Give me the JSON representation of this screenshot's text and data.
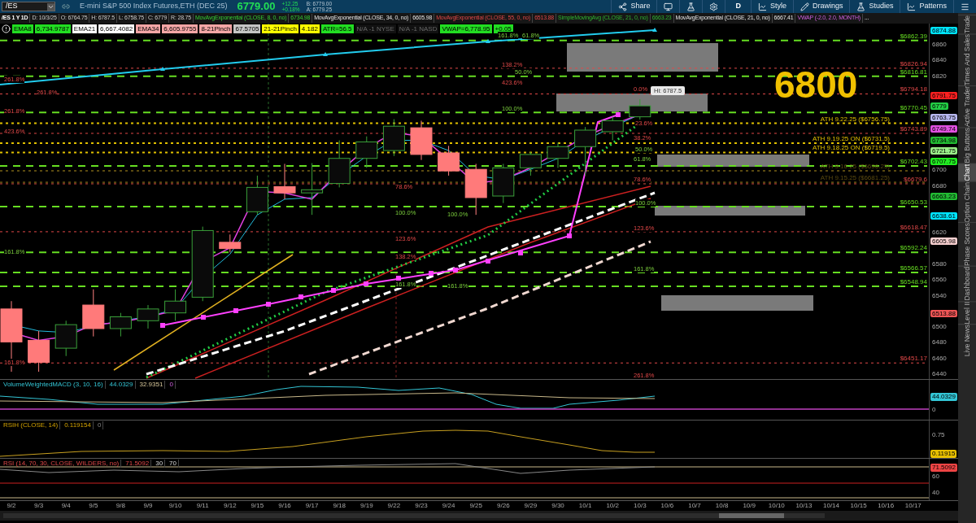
{
  "toolbar": {
    "symbol": "/ES",
    "description": "E-mini S&P 500 Index Futures,ETH (DEC 25)",
    "last": "6779.00",
    "change": "+12.25",
    "change_pct": "+0.18%",
    "bid": "B: 6779.00",
    "ask": "A: 6779.25",
    "buttons": [
      {
        "kind": "share",
        "label": "Share"
      },
      {
        "kind": "screen"
      },
      {
        "kind": "flask"
      },
      {
        "kind": "gear"
      },
      {
        "kind": "text",
        "label": "D"
      },
      {
        "kind": "style",
        "label": "Style"
      },
      {
        "kind": "drawings",
        "label": "Drawings"
      },
      {
        "kind": "studies",
        "label": "Studies"
      },
      {
        "kind": "patterns",
        "label": "Patterns"
      },
      {
        "kind": "menu"
      }
    ]
  },
  "legend": {
    "symbol": "/ES 1 Y 1D",
    "fields": [
      "D: 10/3/25",
      "O: 6764.75",
      "H: 6787.5",
      "L: 6758.75",
      "C: 6779",
      "R: 28.75"
    ],
    "studies": [
      {
        "name": "MovAvgExponential (CLOSE, 8, 0, no)",
        "value": "6734.98",
        "kind": "ema8"
      },
      {
        "name": "MovAvgExponential (CLOSE, 34, 0, no)",
        "value": "6605.98",
        "kind": "ema34"
      },
      {
        "name": "MovAvgExponential (CLOSE, 55, 0, no)",
        "value": "6513.88",
        "kind": "ema55"
      },
      {
        "name": "SimpleMovingAvg (CLOSE, 21, 0, no)",
        "value": "6663.23",
        "kind": "sma21"
      },
      {
        "name": "MovAvgExponential (CLOSE, 21, 0, no)",
        "value": "6667.41",
        "kind": "ema21"
      },
      {
        "name": "VWAP (-2.0, 2.0, MONTH)",
        "kind": "vwap"
      }
    ],
    "more": "..."
  },
  "chips": [
    {
      "text": "EMA8",
      "color": "#22dd22",
      "disabled": false
    },
    {
      "text": "6,734.9787",
      "color": "#22dd22",
      "disabled": false
    },
    {
      "text": "EMA21",
      "color": "#ffffff",
      "disabled": false
    },
    {
      "text": "6,667.4082",
      "color": "#ffffff",
      "disabled": false
    },
    {
      "text": "EMA34",
      "color": "#f4a6a6",
      "disabled": false
    },
    {
      "text": "6,605.9755",
      "color": "#f4a6a6",
      "disabled": false
    },
    {
      "text": "8-21Pinch",
      "color": "#f4a6a6",
      "disabled": false
    },
    {
      "text": "67.5705",
      "color": "#c4c4c4",
      "disabled": false
    },
    {
      "text": "21-21Pinch",
      "color": "#ffff00",
      "disabled": false
    },
    {
      "text": "4.182",
      "color": "#ffff00",
      "disabled": false
    },
    {
      "text": "ATR=56.5",
      "color": "#22dd22",
      "disabled": false
    },
    {
      "text": "N/A -1 NYSE",
      "color": "#111111",
      "disabled": true
    },
    {
      "text": "N/A -1 NASD",
      "color": "#111111",
      "disabled": true
    },
    {
      "text": "VWAP=6,778.95",
      "color": "#22dd22",
      "disabled": false
    },
    {
      "text": "+0.05",
      "color": "#22dd22",
      "disabled": false
    }
  ],
  "callout": "6800",
  "high_label": "Hi: 6787.5",
  "fib_labels": [
    {
      "text": "161.8%",
      "kind": "support"
    },
    {
      "text": "61.8%",
      "kind": "support"
    },
    {
      "text": "138.2%",
      "kind": "resistance"
    },
    {
      "text": "50.0%",
      "kind": "support"
    },
    {
      "text": "261.8%",
      "kind": "resistance"
    },
    {
      "text": "423.6%",
      "kind": "resistance"
    },
    {
      "text": "0.0%",
      "kind": "resistance"
    },
    {
      "text": "261.8%",
      "kind": "resistance"
    },
    {
      "text": "100.0%",
      "kind": "support"
    },
    {
      "text": "261.8%",
      "kind": "resistance"
    },
    {
      "text": "23.6%",
      "kind": "resistance"
    },
    {
      "text": "423.6%",
      "kind": "resistance"
    },
    {
      "text": "38.2%",
      "kind": "resistance"
    },
    {
      "text": "50.0%",
      "kind": "support"
    },
    {
      "text": "61.8%",
      "kind": "support"
    },
    {
      "text": "78.6%",
      "kind": "resistance"
    },
    {
      "text": "78.6%",
      "kind": "resistance"
    },
    {
      "text": "100.0%",
      "kind": "support"
    },
    {
      "text": "100.0%",
      "kind": "support"
    },
    {
      "text": "100.0%",
      "kind": "support"
    },
    {
      "text": "123.6%",
      "kind": "resistance"
    },
    {
      "text": "123.6%",
      "kind": "resistance"
    },
    {
      "text": "161.8%",
      "kind": "support"
    },
    {
      "text": "138.2%",
      "kind": "resistance"
    },
    {
      "text": "161.8%",
      "kind": "support"
    },
    {
      "text": "161.8%",
      "kind": "support"
    },
    {
      "text": "161.8%",
      "kind": "support"
    },
    {
      "text": "161.8%",
      "kind": "resistance"
    },
    {
      "text": "261.8%",
      "kind": "resistance"
    }
  ],
  "levels": [
    {
      "label": "$6862.39",
      "kind": "support"
    },
    {
      "label": "$6826.94",
      "kind": "resistance"
    },
    {
      "label": "$6816.81",
      "kind": "support"
    },
    {
      "label": "$6794.18",
      "kind": "resistance"
    },
    {
      "label": "$6770.45",
      "kind": "support"
    },
    {
      "label": "$6743.89",
      "kind": "resistance"
    },
    {
      "label": "$6702.43",
      "kind": "support"
    },
    {
      "label": "$6679.6",
      "kind": "resistance"
    },
    {
      "label": "$6650.53",
      "kind": "support"
    },
    {
      "label": "$6618.47",
      "kind": "resistance"
    },
    {
      "label": "$6592.24",
      "kind": "support"
    },
    {
      "label": "$6566.57",
      "kind": "support"
    },
    {
      "label": "$6548.94",
      "kind": "support"
    },
    {
      "label": "$6451.17",
      "kind": "resistance"
    }
  ],
  "ath_levels": [
    {
      "label": "ATH 9.22.25  ($6756.75)",
      "disabled": false
    },
    {
      "label": "ATH 9.19.25 ON ($6731.5)",
      "disabled": false
    },
    {
      "label": "ATH 9.18.25 ON ($6719.5)",
      "disabled": false
    },
    {
      "label": "ATH 9.16.25 ($6696.25)",
      "disabled": true
    },
    {
      "label": "ATH 9.15.25 ($6681.25)",
      "disabled": true
    }
  ],
  "price_tags": [
    {
      "value": "6874.88",
      "color": "#00e5ff"
    },
    {
      "value": "6791.75",
      "color": "#ff2020"
    },
    {
      "value": "6779",
      "color": "#22cc44"
    },
    {
      "value": "6763.75",
      "color": "#b8b8f0"
    },
    {
      "value": "6749.74",
      "color": "#e050e0"
    },
    {
      "value": "6734.98",
      "color": "#22bb33"
    },
    {
      "value": "6721.75",
      "color": "#99ee88"
    },
    {
      "value": "6707.75",
      "color": "#22ee22"
    },
    {
      "value": "6663.23",
      "color": "#22bb33"
    },
    {
      "value": "6638.61",
      "color": "#00e5ff"
    },
    {
      "value": "6605.98",
      "color": "#f8d0d0"
    },
    {
      "value": "6513.88",
      "color": "#ee5555"
    }
  ],
  "price_ticks": [
    "6860",
    "6840",
    "6820",
    "6700",
    "6680",
    "6620",
    "6580",
    "6560",
    "6540",
    "6500",
    "6480",
    "6460",
    "6440"
  ],
  "dates": [
    "9/2",
    "9/3",
    "9/4",
    "9/5",
    "9/8",
    "9/9",
    "9/10",
    "9/11",
    "9/12",
    "9/15",
    "9/16",
    "9/17",
    "9/18",
    "9/19",
    "9/22",
    "9/23",
    "9/24",
    "9/25",
    "9/26",
    "9/29",
    "9/30",
    "10/1",
    "10/2",
    "10/3",
    "10/6",
    "10/7",
    "10/8",
    "10/9",
    "10/10",
    "10/13",
    "10/14",
    "10/15",
    "10/16",
    "10/17"
  ],
  "panels": [
    {
      "kind": "macd",
      "title": "VolumeWeightedMACD (3, 10, 16)",
      "values": [
        "44.0329",
        "32.9351",
        "0"
      ],
      "ticks": [
        "0"
      ],
      "tag": {
        "value": "44.0329",
        "color": "#33c5d5"
      }
    },
    {
      "kind": "rsih",
      "title": "RSIH (CLOSE, 14)",
      "values": [
        "0.119154",
        "0"
      ],
      "ticks": [
        "0.75"
      ],
      "tag": {
        "value": "0.11915",
        "color": "#e8c000"
      }
    },
    {
      "kind": "rsi",
      "title": "RSI (14, 70, 30, CLOSE, WILDERS, no)",
      "values": [
        "71.5092",
        "30",
        "70"
      ],
      "ticks": [
        "60",
        "40"
      ],
      "tag": {
        "value": "71.5092",
        "color": "#ee4444"
      }
    }
  ],
  "sidebar_tabs": [
    {
      "label": "Trade",
      "selected": false
    },
    {
      "label": "Times And Sales",
      "selected": false
    },
    {
      "label": "Active Trader",
      "selected": false
    },
    {
      "label": "Big Buttons",
      "selected": false
    },
    {
      "label": "Chart",
      "selected": true
    },
    {
      "label": "Option Chain",
      "selected": false
    },
    {
      "label": "Phase Scores",
      "selected": false
    },
    {
      "label": "Dashboard",
      "selected": false
    },
    {
      "label": "Level II",
      "selected": false
    },
    {
      "label": "Live News",
      "selected": false
    }
  ]
}
